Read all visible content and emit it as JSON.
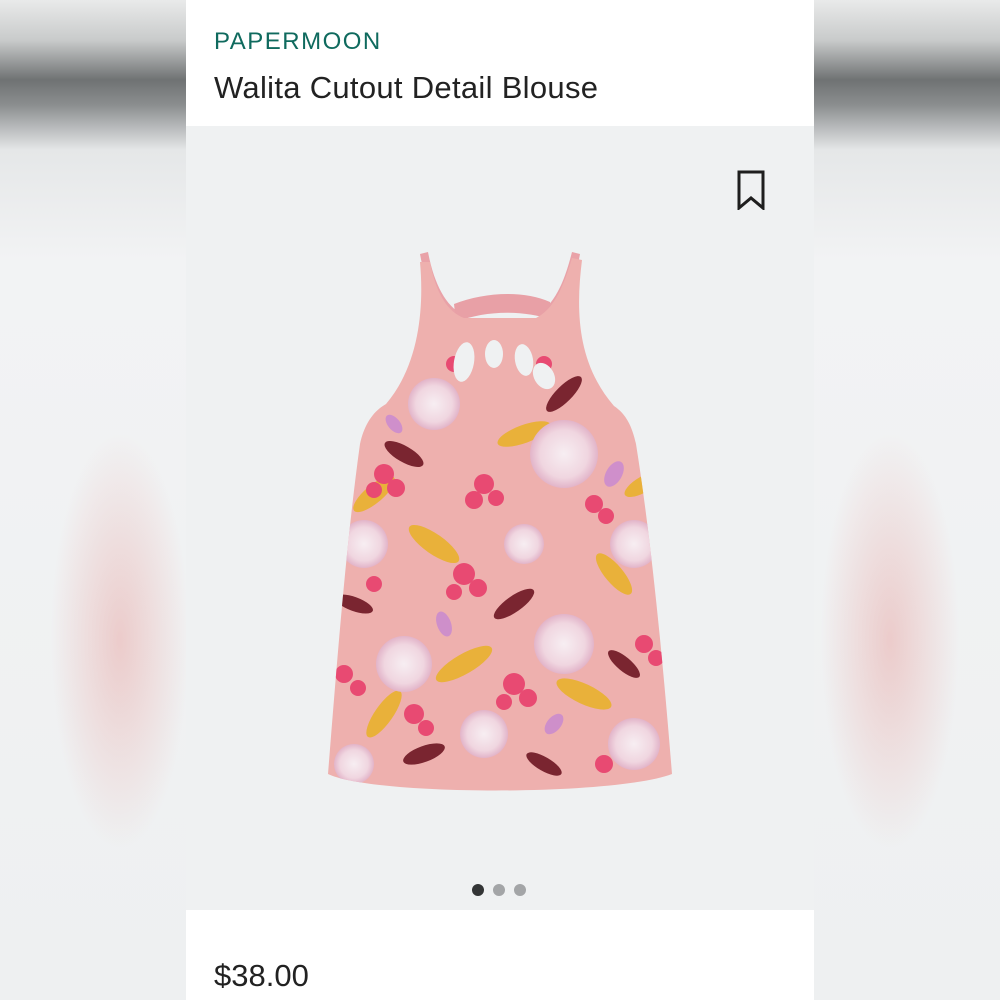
{
  "product": {
    "brand": "PAPERMOON",
    "title": "Walita Cutout Detail Blouse",
    "price": "$38.00",
    "image_alt": "Pink floral halter cutout blouse"
  },
  "carousel": {
    "total": 3,
    "active_index": 0
  },
  "icons": {
    "save": "bookmark-icon"
  },
  "colors": {
    "brand_text": "#0f6a5e",
    "title_text": "#222222",
    "image_bg": "#eff1f2",
    "garment_base": "#eeb0ae",
    "dot_active": "#333536",
    "dot_inactive": "#a3a5a7"
  }
}
